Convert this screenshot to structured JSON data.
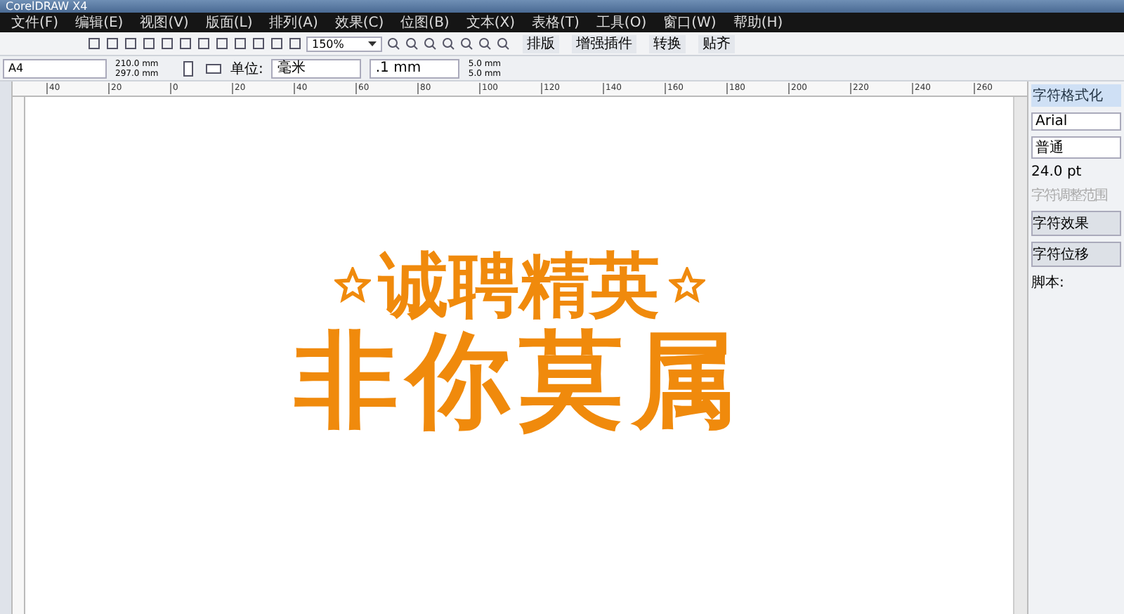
{
  "window": {
    "title": "CorelDRAW X4"
  },
  "menu": [
    "文件(F)",
    "编辑(E)",
    "视图(V)",
    "版面(L)",
    "排列(A)",
    "效果(C)",
    "位图(B)",
    "文本(X)",
    "表格(T)",
    "工具(O)",
    "窗口(W)",
    "帮助(H)"
  ],
  "toolbar": {
    "zoom": "150%",
    "buttons": [
      "排版",
      "增强插件",
      "转换",
      "贴齐"
    ]
  },
  "property_bar": {
    "paper": "A4",
    "width": "210.0 mm",
    "height": "297.0 mm",
    "unit_label": "单位:",
    "unit": "毫米",
    "nudge": ".1 mm",
    "dup_x": "5.0 mm",
    "dup_y": "5.0 mm"
  },
  "ruler": {
    "labels": [
      "40",
      "20",
      "0",
      "20",
      "40",
      "60",
      "80",
      "100",
      "120",
      "140",
      "160",
      "180",
      "200",
      "220",
      "240",
      "260"
    ]
  },
  "artwork": {
    "line1": "诚聘精英",
    "line2": "非你莫属"
  },
  "docker": {
    "title": "字符格式化",
    "font": "Arial",
    "style": "普通",
    "size": "24.0 pt",
    "range_label": "字符调整范围",
    "sections": [
      "字符效果",
      "字符位移"
    ],
    "script_label": "脚本:"
  }
}
